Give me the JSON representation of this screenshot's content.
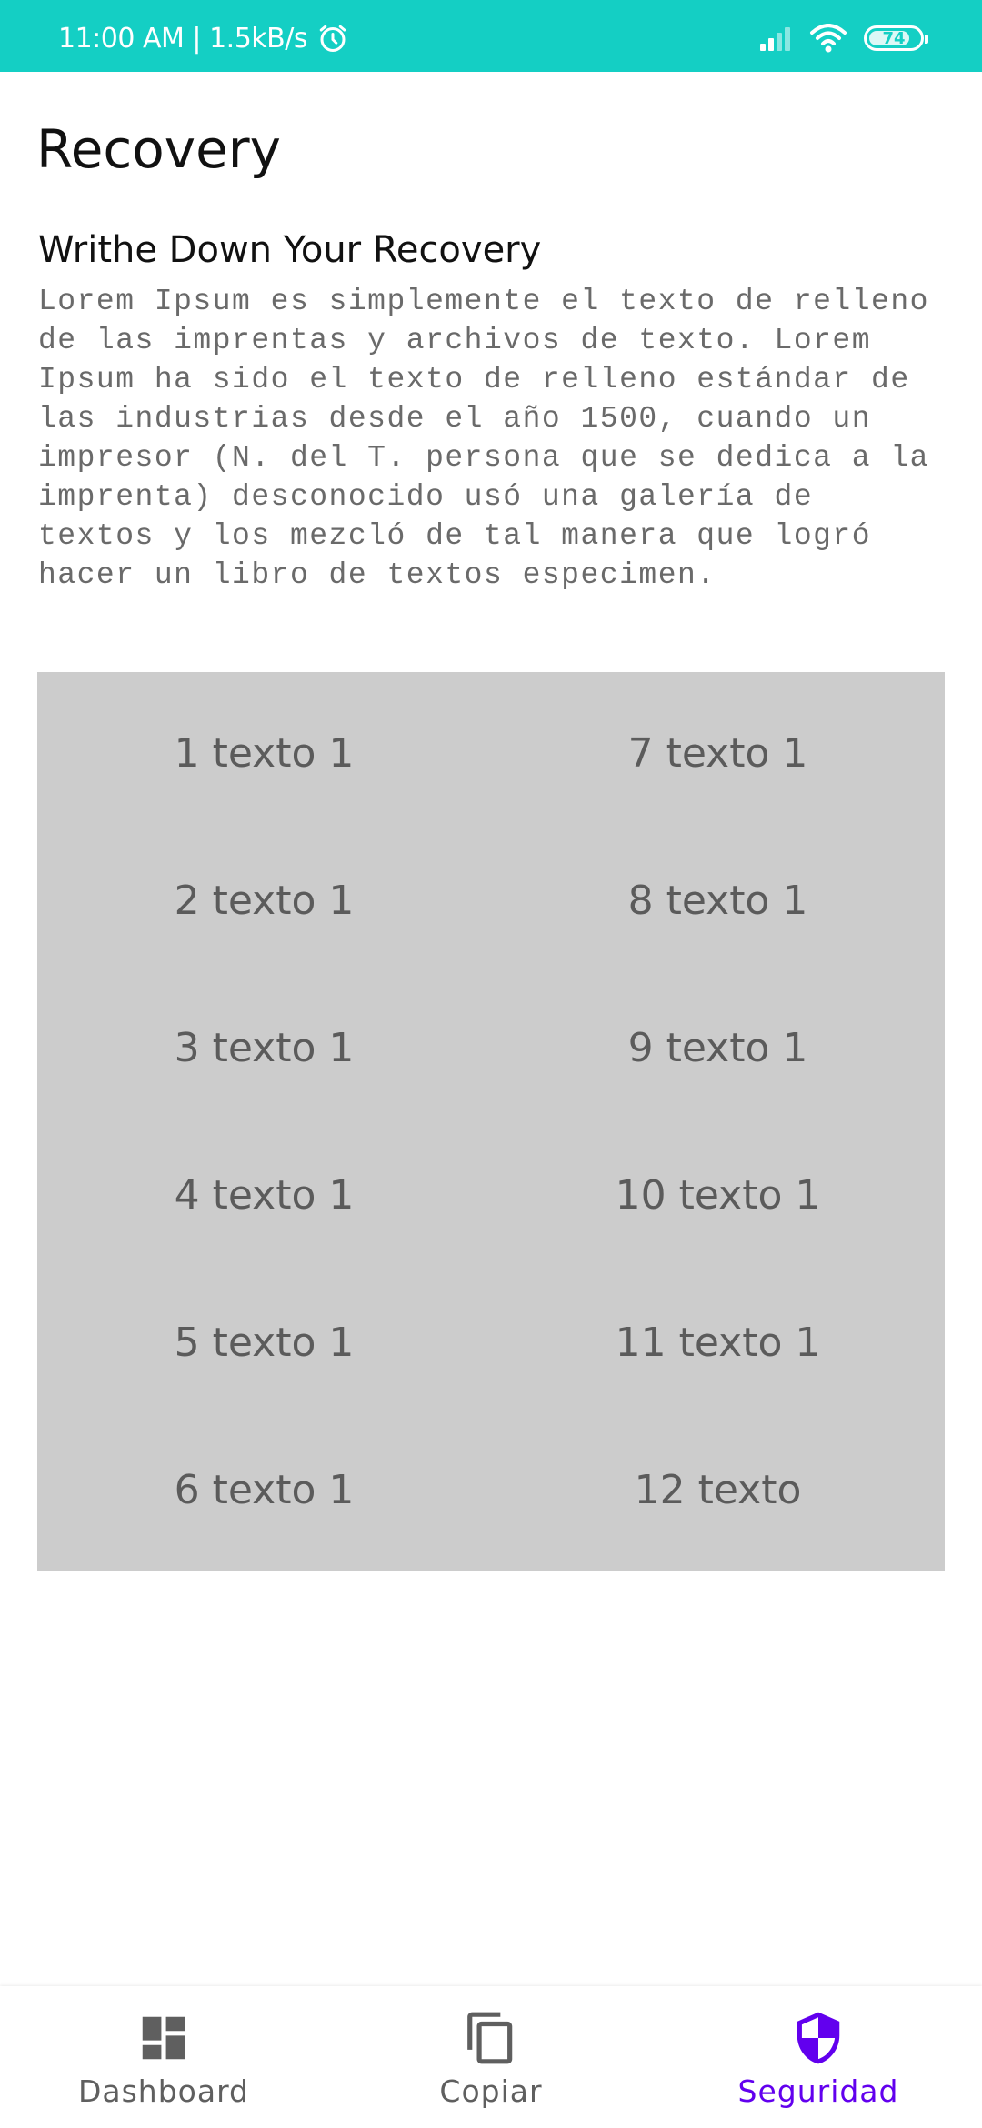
{
  "status_bar": {
    "time": "11:00 AM | 1.5kB/s",
    "battery": "74",
    "icons": [
      "alarm-icon",
      "signal-icon",
      "wifi-icon",
      "battery-icon"
    ]
  },
  "page": {
    "title": "Recovery",
    "section_title": "Writhe Down Your Recovery",
    "description": "Lorem Ipsum es simplemente el texto de relleno de las imprentas y archivos de texto. Lorem Ipsum ha sido el texto de relleno estándar de las industrias desde el año 1500, cuando un impresor (N. del T. persona que se dedica a la imprenta) desconocido usó una galería de textos y los mezcló de tal manera que logró hacer un libro de textos especimen."
  },
  "words": {
    "left": [
      "1 texto 1",
      "2 texto 1",
      "3 texto 1",
      "4 texto 1",
      "5 texto 1",
      "6 texto 1"
    ],
    "right": [
      "7 texto 1",
      "8 texto 1",
      "9 texto 1",
      "10 texto 1",
      "11 texto 1",
      "12 texto"
    ]
  },
  "bottom_nav": {
    "items": [
      {
        "label": "Dashboard",
        "icon": "dashboard-icon",
        "active": false
      },
      {
        "label": "Copiar",
        "icon": "copy-icon",
        "active": false
      },
      {
        "label": "Seguridad",
        "icon": "shield-icon",
        "active": true
      }
    ]
  },
  "colors": {
    "status_bar": "#14cfc4",
    "accent": "#6200ee",
    "grid_bg": "#cccccc",
    "word_text": "#5b5b5b",
    "nav_inactive": "#5f5f5f"
  }
}
